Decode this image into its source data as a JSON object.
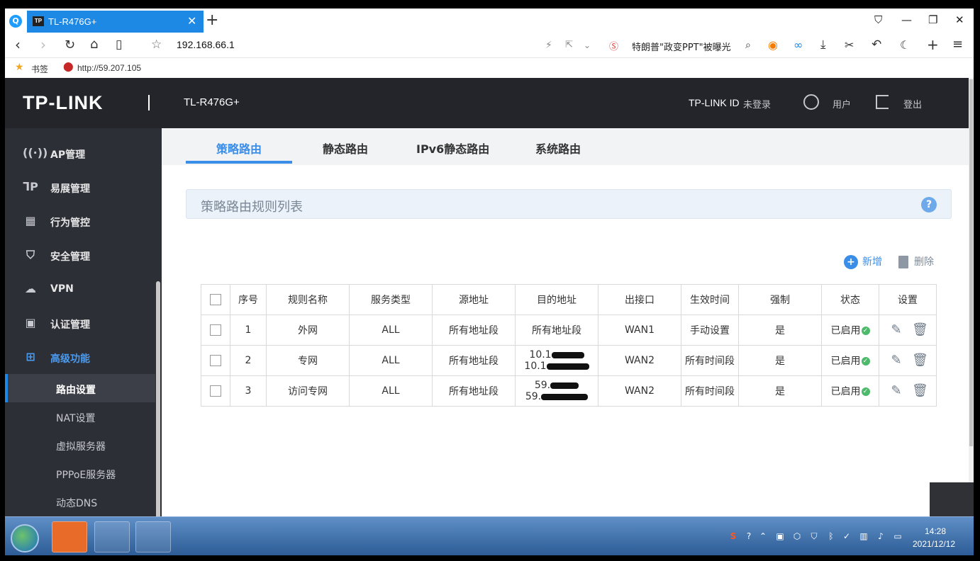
{
  "browser": {
    "tab_title": "TL-R476G+",
    "tab_favicon": "TP",
    "url": "192.168.66.1",
    "search_hint": "特朗普\"政变PPT\"被曝光",
    "bookmarks_label": "书签",
    "bookmark_link": "http://59.207.105"
  },
  "router": {
    "logo": "TP-LINK",
    "model": "TL-R476G+",
    "tpid_label": "TP-LINK ID",
    "tpid_status": "未登录",
    "user_label": "用户",
    "logout_label": "登出"
  },
  "sidebar": {
    "items": [
      {
        "label": "AP管理",
        "icon": "antenna-icon"
      },
      {
        "label": "易展管理",
        "icon": "mesh-icon"
      },
      {
        "label": "行为管控",
        "icon": "behavior-icon"
      },
      {
        "label": "安全管理",
        "icon": "shield-icon"
      },
      {
        "label": "VPN",
        "icon": "vpn-icon"
      },
      {
        "label": "认证管理",
        "icon": "auth-icon"
      },
      {
        "label": "高级功能",
        "icon": "grid-icon"
      }
    ],
    "sub_items": [
      "路由设置",
      "NAT设置",
      "虚拟服务器",
      "PPPoE服务器",
      "动态DNS"
    ],
    "active_color": "#1e88e5"
  },
  "tabs": [
    "策略路由",
    "静态路由",
    "IPv6静态路由",
    "系统路由"
  ],
  "panel_title": "策略路由规则列表",
  "actions": {
    "add": "新增",
    "delete": "删除"
  },
  "table": {
    "headers": [
      "序号",
      "规则名称",
      "服务类型",
      "源地址",
      "目的地址",
      "出接口",
      "生效时间",
      "强制",
      "状态",
      "设置"
    ],
    "rows": [
      {
        "no": "1",
        "name": "外网",
        "service": "ALL",
        "src": "所有地址段",
        "dst1": "所有地址段",
        "dst2": "",
        "iface": "WAN1",
        "time": "手动设置",
        "force": "是",
        "status": "已启用"
      },
      {
        "no": "2",
        "name": "专网",
        "service": "ALL",
        "src": "所有地址段",
        "dst1": "10.1",
        "dst2": "10.1",
        "iface": "WAN2",
        "time": "所有时间段",
        "force": "是",
        "status": "已启用"
      },
      {
        "no": "3",
        "name": "访问专网",
        "service": "ALL",
        "src": "所有地址段",
        "dst1": "59.",
        "dst2": "59.",
        "iface": "WAN2",
        "time": "所有时间段",
        "force": "是",
        "status": "已启用"
      }
    ]
  },
  "taskbar": {
    "time": "14:28",
    "date": "2021/12/12"
  }
}
